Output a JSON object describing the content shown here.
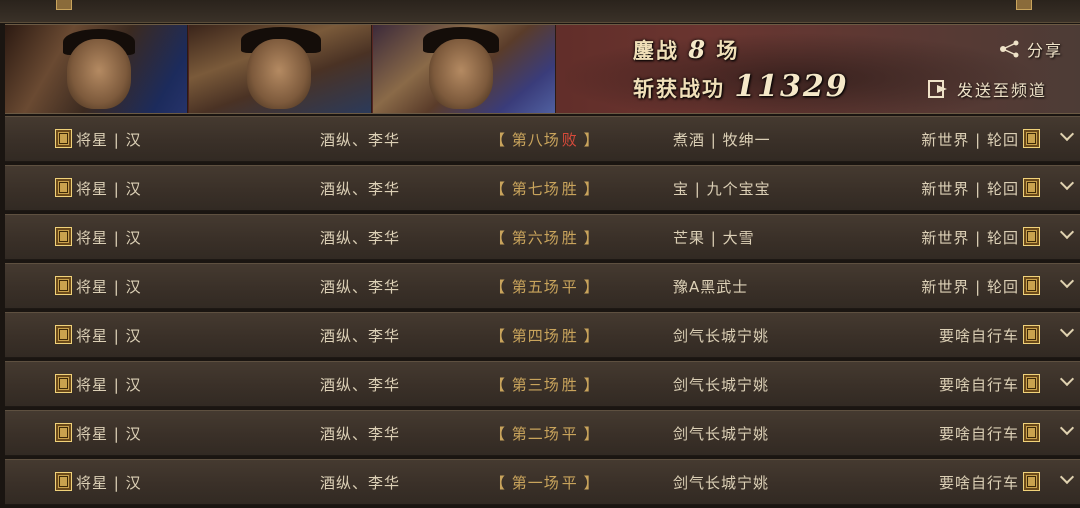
{
  "banner": {
    "battles_label": "鏖战",
    "battles_count": "8",
    "battles_unit": "场",
    "merit_label": "斩获战功",
    "merit_value": "11329",
    "share_label": "分享",
    "send_label": "发送至频道"
  },
  "rows": [
    {
      "left": "将星 | 汉",
      "names": "酒纵、李华",
      "round": "第八场",
      "result": "败",
      "result_type": "lose",
      "opponent_names": "煮酒 | 牧绅一",
      "opponent_server": "新世界 | 轮回"
    },
    {
      "left": "将星 | 汉",
      "names": "酒纵、李华",
      "round": "第七场",
      "result": "胜",
      "result_type": "win",
      "opponent_names": "宝 | 九个宝宝",
      "opponent_server": "新世界 | 轮回"
    },
    {
      "left": "将星 | 汉",
      "names": "酒纵、李华",
      "round": "第六场",
      "result": "胜",
      "result_type": "win",
      "opponent_names": "芒果 | 大雪",
      "opponent_server": "新世界 | 轮回"
    },
    {
      "left": "将星 | 汉",
      "names": "酒纵、李华",
      "round": "第五场",
      "result": "平",
      "result_type": "draw",
      "opponent_names": "豫A黑武士",
      "opponent_server": "新世界 | 轮回"
    },
    {
      "left": "将星 | 汉",
      "names": "酒纵、李华",
      "round": "第四场",
      "result": "胜",
      "result_type": "win",
      "opponent_names": "剑气长城宁姚",
      "opponent_server": "要啥自行车"
    },
    {
      "left": "将星 | 汉",
      "names": "酒纵、李华",
      "round": "第三场",
      "result": "胜",
      "result_type": "win",
      "opponent_names": "剑气长城宁姚",
      "opponent_server": "要啥自行车"
    },
    {
      "left": "将星 | 汉",
      "names": "酒纵、李华",
      "round": "第二场",
      "result": "平",
      "result_type": "draw",
      "opponent_names": "剑气长城宁姚",
      "opponent_server": "要啥自行车"
    },
    {
      "left": "将星 | 汉",
      "names": "酒纵、李华",
      "round": "第一场",
      "result": "平",
      "result_type": "draw",
      "opponent_names": "剑气长城宁姚",
      "opponent_server": "要啥自行车"
    }
  ]
}
